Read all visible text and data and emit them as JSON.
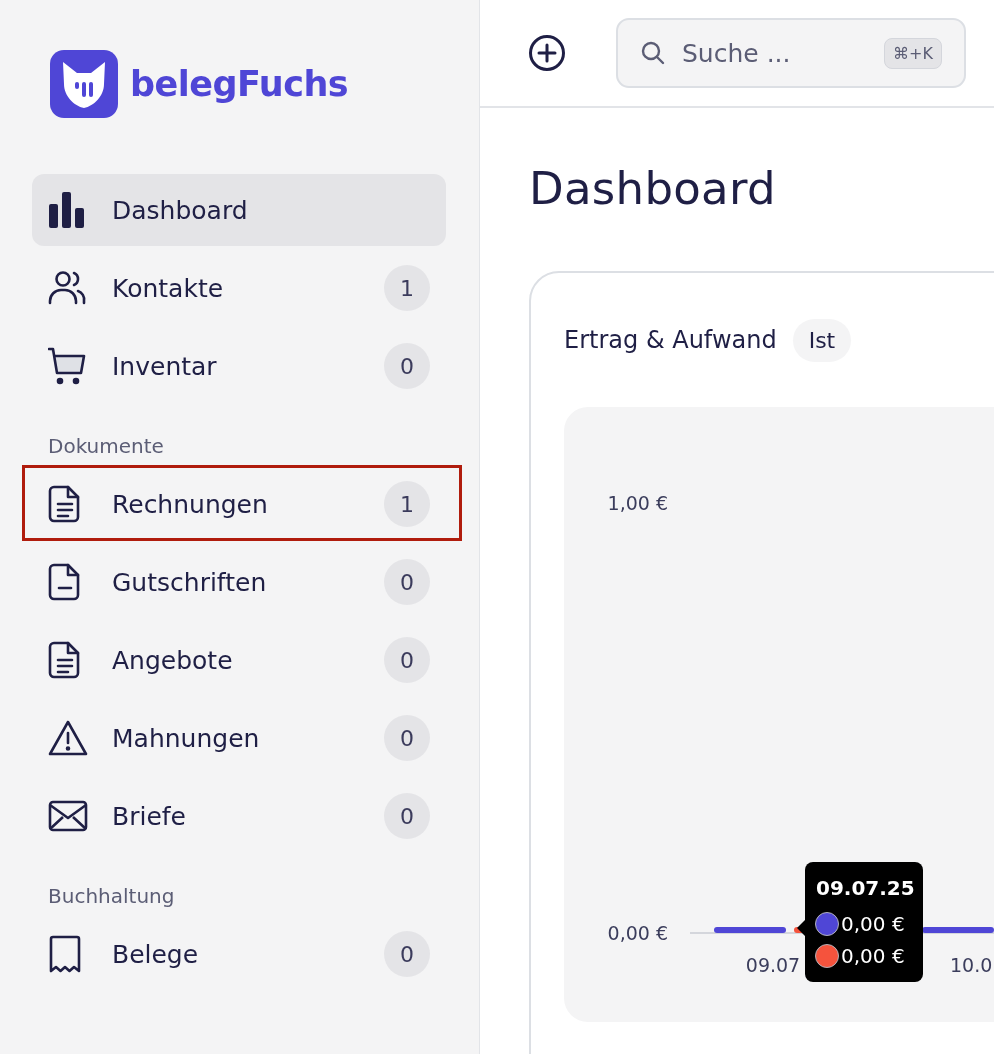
{
  "sidebar": {
    "brand": "belegFuchs",
    "sections": [
      {
        "items": [
          {
            "label": "Dashboard",
            "selected": true,
            "highlighted": false
          },
          {
            "label": "Kontakte",
            "count": "1",
            "selected": false,
            "highlighted": false
          },
          {
            "label": "Inventar",
            "count": "0",
            "selected": false,
            "highlighted": false
          }
        ]
      },
      {
        "heading": "Dokumente",
        "items": [
          {
            "label": "Rechnungen",
            "count": "1",
            "selected": false,
            "highlighted": true
          },
          {
            "label": "Gutschriften",
            "count": "0",
            "selected": false,
            "highlighted": false
          },
          {
            "label": "Angebote",
            "count": "0",
            "selected": false,
            "highlighted": false
          },
          {
            "label": "Mahnungen",
            "count": "0",
            "selected": false,
            "highlighted": false
          },
          {
            "label": "Briefe",
            "count": "0",
            "selected": false,
            "highlighted": false
          }
        ]
      },
      {
        "heading": "Buchhaltung",
        "items": [
          {
            "label": "Belege",
            "count": "0",
            "selected": false,
            "highlighted": false
          }
        ]
      }
    ]
  },
  "topbar": {
    "search": {
      "placeholder": "Suche ...",
      "shortcut": "⌘+K"
    }
  },
  "page": {
    "title": "Dashboard"
  },
  "card": {
    "title": "Ertrag & Aufwand",
    "badge": "Ist",
    "chart_data": {
      "type": "bar",
      "categories": [
        "09.07",
        "10.0"
      ],
      "series": [
        {
          "color": "#4f46d6",
          "values": [
            0,
            0
          ]
        },
        {
          "color": "#f5533d",
          "values": [
            0,
            0
          ]
        }
      ],
      "ylim": [
        0,
        1
      ],
      "yticks": [
        {
          "value": 0,
          "label": "0,00 €"
        },
        {
          "value": 1,
          "label": "1,00 €"
        }
      ]
    },
    "tooltip": {
      "title": "09.07.25",
      "entries": [
        {
          "color": "#4f46d6",
          "value": "0,00 €"
        },
        {
          "color": "#f5533d",
          "value": "0,00 €"
        }
      ]
    }
  }
}
